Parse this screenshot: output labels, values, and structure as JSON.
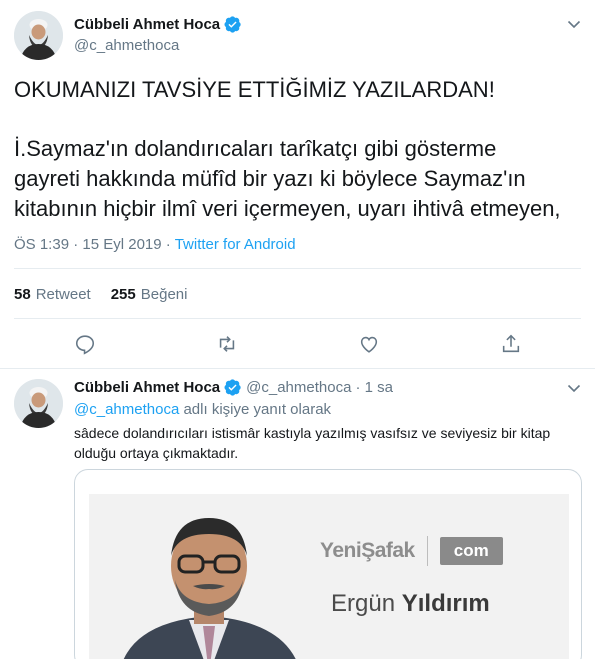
{
  "tweet": {
    "display_name": "Cübbeli Ahmet Hoca",
    "handle": "@c_ahmethoca",
    "text_lines": [
      "OKUMANIZI TAVSİYE ETTİĞİMİZ YAZILARDAN!",
      "İ.Saymaz'ın dolandırıcaları tarîkatçı gibi gösterme",
      "gayreti hakkında müfîd bir yazı ki böylece Saymaz'ın",
      "kitabının hiçbir ilmî veri içermeyen, uyarı ihtivâ etmeyen,"
    ],
    "time": "ÖS 1:39",
    "date_sep": " · ",
    "date": "15 Eyl 2019",
    "source": "Twitter for Android",
    "retweets": "58",
    "retweets_label": "Retweet",
    "likes": "255",
    "likes_label": "Beğeni"
  },
  "reply": {
    "display_name": "Cübbeli Ahmet Hoca",
    "handle": "@c_ahmethoca",
    "time": "· 1 sa",
    "reply_mention": "@c_ahmethoca",
    "reply_suffix": " adlı kişiye yanıt olarak",
    "text_lines": [
      "sâdece dolandırıcıları istismâr kastıyla yazılmış vasıfsız ve seviyesiz bir kitap",
      "olduğu ortaya çıkmaktadır."
    ],
    "card": {
      "brand_name": "YeniŞafak",
      "brand_badge": "com",
      "author_first": "Ergün",
      "author_last": "Yıldırım"
    }
  },
  "colors": {
    "accent": "#1da1f2",
    "text": "#14171a",
    "muted": "#657786",
    "border": "#e6ecf0"
  },
  "icons": [
    "verified-icon",
    "chevron-down-icon",
    "reply-icon",
    "retweet-icon",
    "like-icon",
    "share-icon"
  ]
}
